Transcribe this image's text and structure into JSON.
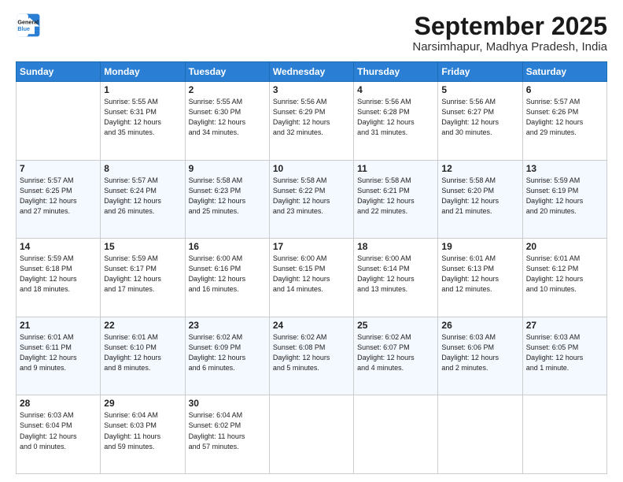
{
  "logo": {
    "line1": "General",
    "line2": "Blue"
  },
  "header": {
    "month": "September 2025",
    "location": "Narsimhapur, Madhya Pradesh, India"
  },
  "weekdays": [
    "Sunday",
    "Monday",
    "Tuesday",
    "Wednesday",
    "Thursday",
    "Friday",
    "Saturday"
  ],
  "weeks": [
    [
      {
        "day": "",
        "info": ""
      },
      {
        "day": "1",
        "info": "Sunrise: 5:55 AM\nSunset: 6:31 PM\nDaylight: 12 hours\nand 35 minutes."
      },
      {
        "day": "2",
        "info": "Sunrise: 5:55 AM\nSunset: 6:30 PM\nDaylight: 12 hours\nand 34 minutes."
      },
      {
        "day": "3",
        "info": "Sunrise: 5:56 AM\nSunset: 6:29 PM\nDaylight: 12 hours\nand 32 minutes."
      },
      {
        "day": "4",
        "info": "Sunrise: 5:56 AM\nSunset: 6:28 PM\nDaylight: 12 hours\nand 31 minutes."
      },
      {
        "day": "5",
        "info": "Sunrise: 5:56 AM\nSunset: 6:27 PM\nDaylight: 12 hours\nand 30 minutes."
      },
      {
        "day": "6",
        "info": "Sunrise: 5:57 AM\nSunset: 6:26 PM\nDaylight: 12 hours\nand 29 minutes."
      }
    ],
    [
      {
        "day": "7",
        "info": "Sunrise: 5:57 AM\nSunset: 6:25 PM\nDaylight: 12 hours\nand 27 minutes."
      },
      {
        "day": "8",
        "info": "Sunrise: 5:57 AM\nSunset: 6:24 PM\nDaylight: 12 hours\nand 26 minutes."
      },
      {
        "day": "9",
        "info": "Sunrise: 5:58 AM\nSunset: 6:23 PM\nDaylight: 12 hours\nand 25 minutes."
      },
      {
        "day": "10",
        "info": "Sunrise: 5:58 AM\nSunset: 6:22 PM\nDaylight: 12 hours\nand 23 minutes."
      },
      {
        "day": "11",
        "info": "Sunrise: 5:58 AM\nSunset: 6:21 PM\nDaylight: 12 hours\nand 22 minutes."
      },
      {
        "day": "12",
        "info": "Sunrise: 5:58 AM\nSunset: 6:20 PM\nDaylight: 12 hours\nand 21 minutes."
      },
      {
        "day": "13",
        "info": "Sunrise: 5:59 AM\nSunset: 6:19 PM\nDaylight: 12 hours\nand 20 minutes."
      }
    ],
    [
      {
        "day": "14",
        "info": "Sunrise: 5:59 AM\nSunset: 6:18 PM\nDaylight: 12 hours\nand 18 minutes."
      },
      {
        "day": "15",
        "info": "Sunrise: 5:59 AM\nSunset: 6:17 PM\nDaylight: 12 hours\nand 17 minutes."
      },
      {
        "day": "16",
        "info": "Sunrise: 6:00 AM\nSunset: 6:16 PM\nDaylight: 12 hours\nand 16 minutes."
      },
      {
        "day": "17",
        "info": "Sunrise: 6:00 AM\nSunset: 6:15 PM\nDaylight: 12 hours\nand 14 minutes."
      },
      {
        "day": "18",
        "info": "Sunrise: 6:00 AM\nSunset: 6:14 PM\nDaylight: 12 hours\nand 13 minutes."
      },
      {
        "day": "19",
        "info": "Sunrise: 6:01 AM\nSunset: 6:13 PM\nDaylight: 12 hours\nand 12 minutes."
      },
      {
        "day": "20",
        "info": "Sunrise: 6:01 AM\nSunset: 6:12 PM\nDaylight: 12 hours\nand 10 minutes."
      }
    ],
    [
      {
        "day": "21",
        "info": "Sunrise: 6:01 AM\nSunset: 6:11 PM\nDaylight: 12 hours\nand 9 minutes."
      },
      {
        "day": "22",
        "info": "Sunrise: 6:01 AM\nSunset: 6:10 PM\nDaylight: 12 hours\nand 8 minutes."
      },
      {
        "day": "23",
        "info": "Sunrise: 6:02 AM\nSunset: 6:09 PM\nDaylight: 12 hours\nand 6 minutes."
      },
      {
        "day": "24",
        "info": "Sunrise: 6:02 AM\nSunset: 6:08 PM\nDaylight: 12 hours\nand 5 minutes."
      },
      {
        "day": "25",
        "info": "Sunrise: 6:02 AM\nSunset: 6:07 PM\nDaylight: 12 hours\nand 4 minutes."
      },
      {
        "day": "26",
        "info": "Sunrise: 6:03 AM\nSunset: 6:06 PM\nDaylight: 12 hours\nand 2 minutes."
      },
      {
        "day": "27",
        "info": "Sunrise: 6:03 AM\nSunset: 6:05 PM\nDaylight: 12 hours\nand 1 minute."
      }
    ],
    [
      {
        "day": "28",
        "info": "Sunrise: 6:03 AM\nSunset: 6:04 PM\nDaylight: 12 hours\nand 0 minutes."
      },
      {
        "day": "29",
        "info": "Sunrise: 6:04 AM\nSunset: 6:03 PM\nDaylight: 11 hours\nand 59 minutes."
      },
      {
        "day": "30",
        "info": "Sunrise: 6:04 AM\nSunset: 6:02 PM\nDaylight: 11 hours\nand 57 minutes."
      },
      {
        "day": "",
        "info": ""
      },
      {
        "day": "",
        "info": ""
      },
      {
        "day": "",
        "info": ""
      },
      {
        "day": "",
        "info": ""
      }
    ]
  ]
}
